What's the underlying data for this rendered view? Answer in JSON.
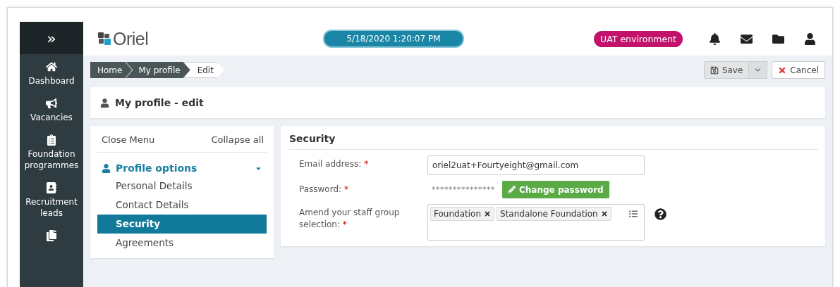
{
  "sidebar": {
    "toggle": "»",
    "items": [
      {
        "kind": "nav",
        "label": "Dashboard"
      },
      {
        "kind": "nav",
        "label": "Vacancies"
      },
      {
        "kind": "nav",
        "label": "Foundation programmes"
      },
      {
        "kind": "nav",
        "label": "Recruitment leads"
      },
      {
        "kind": "partial"
      }
    ]
  },
  "header": {
    "logo": "Oriel",
    "clock": "5/18/2020 1:20:07 PM",
    "environment": "UAT environment"
  },
  "breadcrumb": [
    {
      "label": "Home",
      "current": false
    },
    {
      "label": "My profile",
      "current": false
    },
    {
      "label": "Edit",
      "current": true
    }
  ],
  "actions": {
    "save": "Save",
    "cancel": "Cancel"
  },
  "page_title": "My profile - edit",
  "menu": {
    "close": "Close Menu",
    "collapse": "Collapse all",
    "group": {
      "label": "Profile options",
      "expanded": true
    },
    "items": [
      {
        "label": "Personal Details",
        "selected": false
      },
      {
        "label": "Contact Details",
        "selected": false
      },
      {
        "label": "Security",
        "selected": true
      },
      {
        "label": "Agreements",
        "selected": false
      }
    ]
  },
  "section": {
    "title": "Security",
    "required_mark": "*",
    "fields": [
      {
        "kind": "input",
        "label": "Email address:",
        "required": true,
        "value": "oriel2uat+Fourtyeight@gmail.com"
      },
      {
        "kind": "password",
        "label": "Password:",
        "required": true,
        "value": "***************",
        "button": "Change password"
      },
      {
        "kind": "tags",
        "label": "Amend your staff group selection:",
        "required": true,
        "tags": [
          "Foundation",
          "Standalone Foundation"
        ]
      }
    ]
  }
}
